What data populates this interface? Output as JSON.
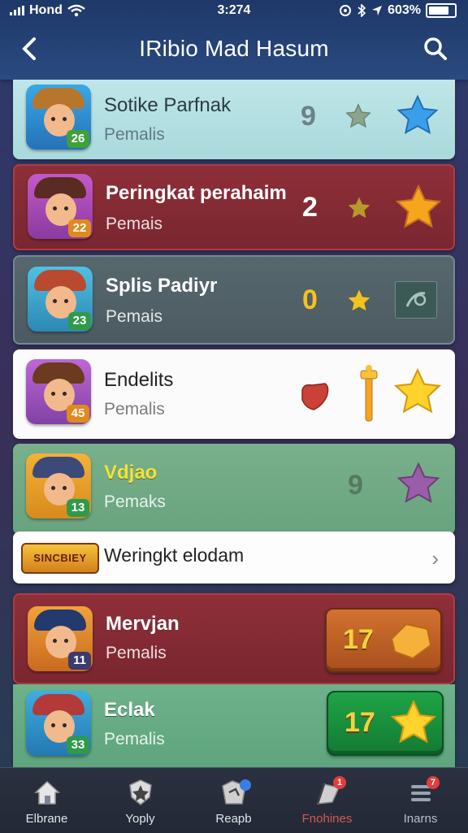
{
  "status_bar": {
    "carrier": "Hond",
    "time": "3:274",
    "battery": "603%"
  },
  "header": {
    "title": "IRibio Mad Hasum"
  },
  "rows": [
    {
      "name": "Sotike Parfnak",
      "sub": "Pemalis",
      "level": "26",
      "count": "9"
    },
    {
      "name": "Peringkat perahaim",
      "sub": "Pemais",
      "level": "22",
      "count": "2"
    },
    {
      "name": "Splis Padiyr",
      "sub": "Pemais",
      "level": "23",
      "count": "0"
    },
    {
      "name": "Endelits",
      "sub": "Pemalis",
      "level": "45"
    },
    {
      "name": "Vdjao",
      "sub": "Pemaks",
      "level": "13",
      "count": "9"
    },
    {
      "logo": "SINCBIEY",
      "name": "Weringkt elodam"
    },
    {
      "name": "Mervjan",
      "sub": "Pemalis",
      "level": "11",
      "badge": "17"
    },
    {
      "name": "Eclak",
      "sub": "Pemalis",
      "level": "33",
      "badge": "17"
    }
  ],
  "tabs": [
    {
      "label": "Elbrane",
      "icon": "home-icon",
      "active": false
    },
    {
      "label": "Yoply",
      "icon": "shield-icon",
      "active": false
    },
    {
      "label": "Reapb",
      "icon": "map-icon",
      "active": false,
      "dot": ""
    },
    {
      "label": "Fnohines",
      "icon": "flag-icon",
      "active": true,
      "dot": "1"
    },
    {
      "label": "Inarns",
      "icon": "menu-icon",
      "active": false,
      "dot": "7"
    }
  ],
  "colors": {
    "active_tab": "#d35b4e",
    "accent_star": "#f5c52e",
    "nav_bg": "#1e3868"
  }
}
